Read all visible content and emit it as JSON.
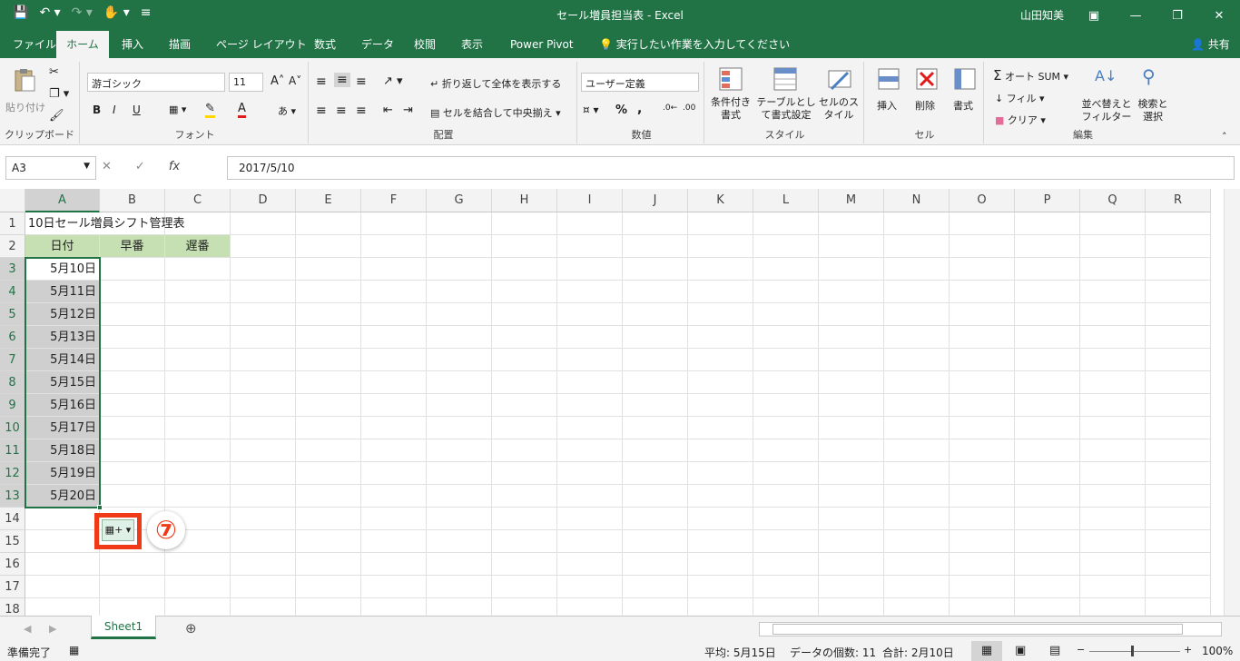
{
  "window": {
    "title": "セール増員担当表  -  Excel",
    "user": "山田知美",
    "share": "共有"
  },
  "tabs": [
    "ファイル",
    "ホーム",
    "挿入",
    "描画",
    "ページ レイアウト",
    "数式",
    "データ",
    "校閲",
    "表示",
    "Power Pivot"
  ],
  "active_tab": "ホーム",
  "tell_me": "実行したい作業を入力してください",
  "ribbon": {
    "clipboard": {
      "paste": "貼り付け",
      "label": "クリップボード"
    },
    "font": {
      "name": "游ゴシック",
      "size": "11",
      "label": "フォント",
      "bold": "B",
      "italic": "I",
      "underline": "U"
    },
    "alignment": {
      "wrap": "折り返して全体を表示する",
      "merge": "セルを結合して中央揃え",
      "label": "配置"
    },
    "number": {
      "format": "ユーザー定義",
      "label": "数値"
    },
    "styles": {
      "conditional": "条件付き書式",
      "table": "テーブルとして書式設定",
      "cell": "セルのスタイル",
      "label": "スタイル"
    },
    "cells": {
      "insert": "挿入",
      "delete": "削除",
      "format": "書式",
      "label": "セル"
    },
    "editing": {
      "autosum": "オート SUM",
      "fill": "フィル",
      "clear": "クリア",
      "sort": "並べ替えとフィルター",
      "find": "検索と選択",
      "label": "編集"
    }
  },
  "formula_bar": {
    "name_box": "A3",
    "formula": "2017/5/10"
  },
  "columns": [
    "A",
    "B",
    "C",
    "D",
    "E",
    "F",
    "G",
    "H",
    "I",
    "J",
    "K",
    "L",
    "M",
    "N",
    "O",
    "P",
    "Q",
    "R"
  ],
  "rows": [
    "1",
    "2",
    "3",
    "4",
    "5",
    "6",
    "7",
    "8",
    "9",
    "10",
    "11",
    "12",
    "13",
    "14",
    "15",
    "16",
    "17",
    "18"
  ],
  "cells": {
    "A1": "10日セール増員シフト管理表",
    "A2": "日付",
    "B2": "早番",
    "C2": "遅番",
    "dates": [
      "5月10日",
      "5月11日",
      "5月12日",
      "5月13日",
      "5月14日",
      "5月15日",
      "5月16日",
      "5月17日",
      "5月18日",
      "5月19日",
      "5月20日"
    ]
  },
  "annotation": {
    "step": "⑦"
  },
  "sheet_tab": "Sheet1",
  "status": {
    "ready": "準備完了",
    "average": "平均:  5月15日",
    "count": "データの個数:  11",
    "sum": "合計:  2月10日",
    "zoom": "100%"
  }
}
